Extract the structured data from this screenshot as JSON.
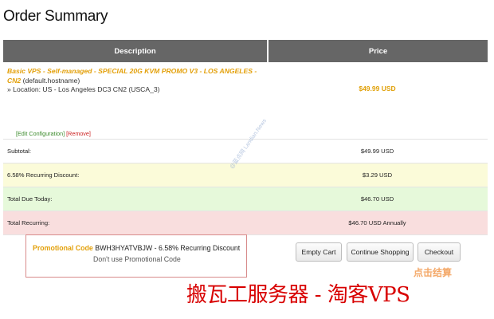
{
  "page": {
    "title": "Order Summary"
  },
  "table": {
    "headers": {
      "description": "Description",
      "price": "Price"
    },
    "product": {
      "name": "Basic VPS - Self-managed - SPECIAL 20G KVM PROMO V3 - LOS ANGELES - CN2",
      "hostname": "(default.hostname)",
      "location": "» Location: US - Los Angeles DC3 CN2 (USCA_3)",
      "edit_config": "[Edit Configuration]",
      "remove": "[Remove]",
      "price": "$49.99 USD"
    },
    "rows": [
      {
        "label": "Subtotal:",
        "value": "$49.99 USD"
      },
      {
        "label": "6.58% Recurring Discount:",
        "value": "$3.29 USD"
      },
      {
        "label": "Total Due Today:",
        "value": "$46.70 USD"
      },
      {
        "label": "Total Recurring:",
        "value": "$46.70 USD Annually"
      }
    ]
  },
  "promo": {
    "label": "Promotional Code",
    "code": "BWH3HYATVBJW - 6.58% Recurring Discount",
    "remove": "Don't use Promotional Code"
  },
  "buttons": {
    "empty_cart": "Empty Cart",
    "continue": "Continue Shopping",
    "checkout": "Checkout"
  },
  "checkout_note": "点击结算",
  "watermark": "@蓝点网 Landian.News",
  "caption": "搬瓦工服务器 - 淘客VPS",
  "colors": {
    "header_bg": "#666666",
    "product_name": "#e3a00a",
    "discount_row": "#fbfbd9",
    "total_row": "#e6f9da",
    "recurring_row": "#f9dede",
    "caption": "#d80000"
  }
}
